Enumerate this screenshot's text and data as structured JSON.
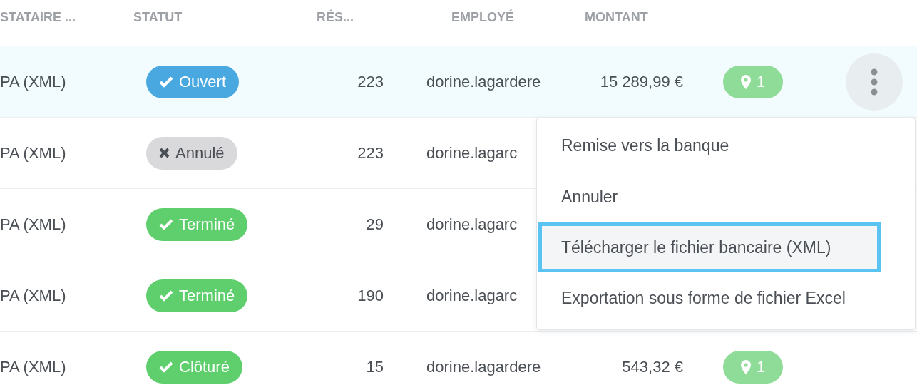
{
  "table": {
    "columns": [
      {
        "label": "STATAIRE ..."
      },
      {
        "label": "STATUT"
      },
      {
        "label": "RÉS..."
      },
      {
        "label": "EMPLOYÉ"
      },
      {
        "label": "MONTANT"
      }
    ],
    "rows": [
      {
        "selected": true,
        "column_1": "PA (XML)",
        "status": {
          "kind": "open",
          "label": "Ouvert"
        },
        "count": "223",
        "employee": "dorine.lagardere",
        "amount": "15 289,99 €",
        "locations": "1",
        "has_menu_button": true
      },
      {
        "selected": false,
        "column_1": "PA (XML)",
        "status": {
          "kind": "cancelled",
          "label": "Annulé"
        },
        "count": "223",
        "employee": "dorine.lagarc"
      },
      {
        "selected": false,
        "column_1": "PA (XML)",
        "status": {
          "kind": "done",
          "label": "Terminé"
        },
        "count": "29",
        "employee": "dorine.lagarc"
      },
      {
        "selected": false,
        "column_1": "PA (XML)",
        "status": {
          "kind": "done",
          "label": "Terminé"
        },
        "count": "190",
        "employee": "dorine.lagarc"
      },
      {
        "selected": false,
        "column_1": "PA (XML)",
        "status": {
          "kind": "done",
          "label": "Clôturé"
        },
        "count": "15",
        "employee": "dorine.lagardere",
        "amount": "543,32 €",
        "locations": "1",
        "has_menu_button": false
      }
    ]
  },
  "menu": {
    "items": [
      {
        "label": "Remise vers la banque",
        "selected": false
      },
      {
        "label": "Annuler",
        "selected": false
      },
      {
        "label": "Télécharger le fichier bancaire (XML)",
        "selected": true
      },
      {
        "label": "Exportation sous forme de fichier Excel",
        "selected": false
      }
    ]
  }
}
